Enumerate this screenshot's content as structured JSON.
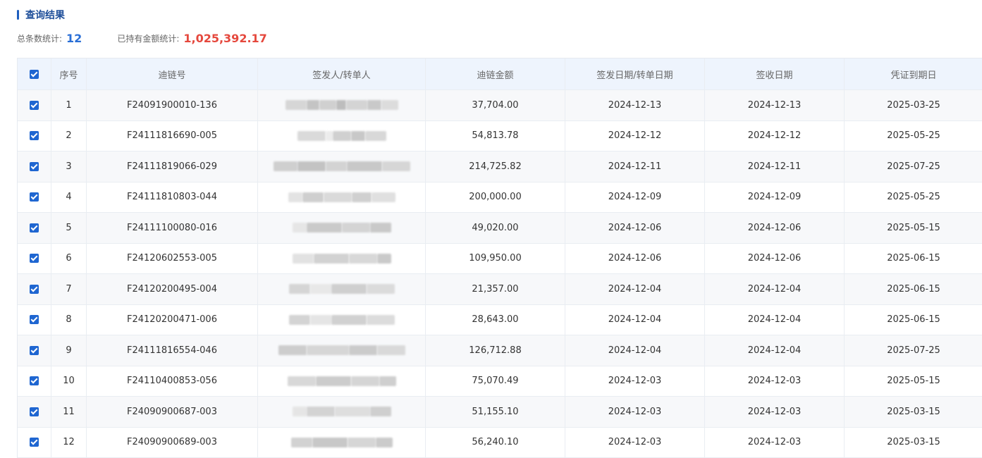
{
  "header": {
    "title": "查询结果",
    "count_label": "总条数统计:",
    "count_value": "12",
    "amount_label": "已持有金额统计:",
    "amount_value": "1,025,392.17"
  },
  "colors": {
    "accent": "#1f66d1",
    "amount": "#e5483d",
    "header_bg": "#eef4fd"
  },
  "table": {
    "columns": [
      "序号",
      "迪链号",
      "签发人/转单人",
      "迪链金额",
      "签发日期/转单日期",
      "签收日期",
      "凭证到期日"
    ],
    "rows": [
      {
        "no": "1",
        "id": "F24091900010-136",
        "amount": "37,704.00",
        "issue": "2024-12-13",
        "sign": "2024-12-13",
        "due": "2025-03-25"
      },
      {
        "no": "2",
        "id": "F24111816690-005",
        "amount": "54,813.78",
        "issue": "2024-12-12",
        "sign": "2024-12-12",
        "due": "2025-05-25"
      },
      {
        "no": "3",
        "id": "F24111819066-029",
        "amount": "214,725.82",
        "issue": "2024-12-11",
        "sign": "2024-12-11",
        "due": "2025-07-25"
      },
      {
        "no": "4",
        "id": "F24111810803-044",
        "amount": "200,000.00",
        "issue": "2024-12-09",
        "sign": "2024-12-09",
        "due": "2025-05-25"
      },
      {
        "no": "5",
        "id": "F24111100080-016",
        "amount": "49,020.00",
        "issue": "2024-12-06",
        "sign": "2024-12-06",
        "due": "2025-05-15"
      },
      {
        "no": "6",
        "id": "F24120602553-005",
        "amount": "109,950.00",
        "issue": "2024-12-06",
        "sign": "2024-12-06",
        "due": "2025-06-15"
      },
      {
        "no": "7",
        "id": "F24120200495-004",
        "amount": "21,357.00",
        "issue": "2024-12-04",
        "sign": "2024-12-04",
        "due": "2025-06-15"
      },
      {
        "no": "8",
        "id": "F24120200471-006",
        "amount": "28,643.00",
        "issue": "2024-12-04",
        "sign": "2024-12-04",
        "due": "2025-06-15"
      },
      {
        "no": "9",
        "id": "F24111816554-046",
        "amount": "126,712.88",
        "issue": "2024-12-04",
        "sign": "2024-12-04",
        "due": "2025-07-25"
      },
      {
        "no": "10",
        "id": "F24110400853-056",
        "amount": "75,070.49",
        "issue": "2024-12-03",
        "sign": "2024-12-03",
        "due": "2025-05-15"
      },
      {
        "no": "11",
        "id": "F24090900687-003",
        "amount": "51,155.10",
        "issue": "2024-12-03",
        "sign": "2024-12-03",
        "due": "2025-03-15"
      },
      {
        "no": "12",
        "id": "F24090900689-003",
        "amount": "56,240.10",
        "issue": "2024-12-03",
        "sign": "2024-12-03",
        "due": "2025-03-15"
      }
    ]
  }
}
